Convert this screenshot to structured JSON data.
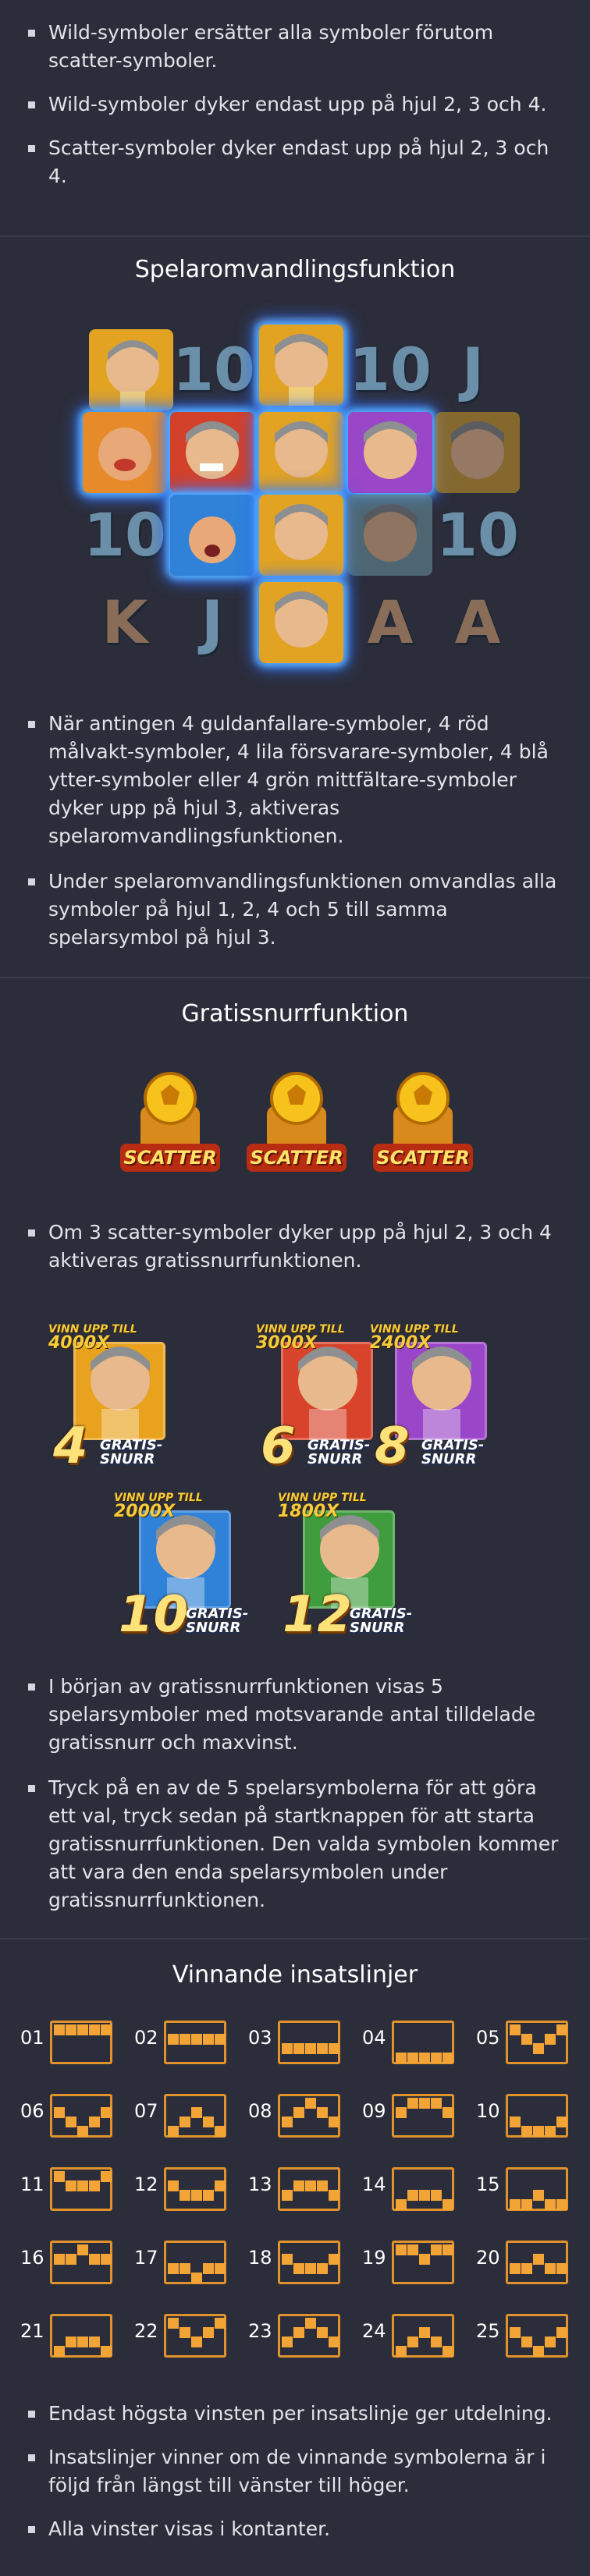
{
  "intro_rules": [
    "Wild-symboler ersätter alla symboler förutom scatter-symboler.",
    "Wild-symboler dyker endast upp på hjul 2, 3 och 4.",
    "Scatter-symboler dyker endast upp på hjul 2, 3 och 4."
  ],
  "player_transform": {
    "title": "Spelaromvandlingsfunktion",
    "rules": [
      "När antingen 4 guldanfallare-symboler, 4 röd målvakt-symboler, 4 lila försvarare-symboler, 4 blå ytter-symboler eller 4 grön mittfältare-symboler dyker upp på hjul 3, aktiveras spelaromvandlingsfunktionen.",
      "Under spelaromvandlingsfunktionen omvandlas alla symboler på hjul 1, 2, 4 och 5 till samma spelarsymbol på hjul 3."
    ],
    "reel_letters": {
      "ten": "10",
      "j": "J",
      "k": "K",
      "a": "A"
    }
  },
  "free_spins": {
    "title": "Gratissnurrfunktion",
    "scatter_label": "SCATTER",
    "trigger_rule": "Om 3 scatter-symboler dyker upp på hjul 2, 3 och 4 aktiveras gratissnurrfunktionen.",
    "options": [
      {
        "tag": "VINN UPP TILL",
        "multiplier": "4000X",
        "spins": "4",
        "word": "GRATIS-\nSNURR",
        "color": "#e8a21e"
      },
      {
        "tag": "VINN UPP TILL",
        "multiplier": "3000X",
        "spins": "6",
        "word": "GRATIS-\nSNURR",
        "color": "#d8432b"
      },
      {
        "tag": "VINN UPP TILL",
        "multiplier": "2400X",
        "spins": "8",
        "word": "GRATIS-\nSNURR",
        "color": "#9a46c8"
      },
      {
        "tag": "VINN UPP TILL",
        "multiplier": "2000X",
        "spins": "10",
        "word": "GRATIS-\nSNURR",
        "color": "#2f82d8"
      },
      {
        "tag": "VINN UPP TILL",
        "multiplier": "1800X",
        "spins": "12",
        "word": "GRATIS-\nSNURR",
        "color": "#3f9d3e"
      }
    ],
    "rules": [
      "I början av gratissnurrfunktionen visas 5 spelarsymboler med motsvarande antal tilldelade gratissnurr och maxvinst.",
      "Tryck på en av de 5 spelarsymbolerna för att göra ett val, tryck sedan på startknappen för att starta gratissnurrfunktionen. Den valda symbolen kommer att vara den enda spelarsymbolen under gratissnurrfunktionen."
    ]
  },
  "paylines": {
    "title": "Vinnande insatslinjer",
    "lines": [
      {
        "num": "01",
        "rows": [
          0,
          0,
          0,
          0,
          0
        ]
      },
      {
        "num": "02",
        "rows": [
          1,
          1,
          1,
          1,
          1
        ]
      },
      {
        "num": "03",
        "rows": [
          2,
          2,
          2,
          2,
          2
        ]
      },
      {
        "num": "04",
        "rows": [
          3,
          3,
          3,
          3,
          3
        ]
      },
      {
        "num": "05",
        "rows": [
          0,
          1,
          2,
          1,
          0
        ]
      },
      {
        "num": "06",
        "rows": [
          1,
          2,
          3,
          2,
          1
        ]
      },
      {
        "num": "07",
        "rows": [
          3,
          2,
          1,
          2,
          3
        ]
      },
      {
        "num": "08",
        "rows": [
          2,
          1,
          0,
          1,
          2
        ]
      },
      {
        "num": "09",
        "rows": [
          1,
          0,
          0,
          0,
          1
        ]
      },
      {
        "num": "10",
        "rows": [
          2,
          3,
          3,
          3,
          2
        ]
      },
      {
        "num": "11",
        "rows": [
          0,
          1,
          1,
          1,
          0
        ]
      },
      {
        "num": "12",
        "rows": [
          1,
          2,
          2,
          2,
          1
        ]
      },
      {
        "num": "13",
        "rows": [
          2,
          1,
          1,
          1,
          2
        ]
      },
      {
        "num": "14",
        "rows": [
          3,
          2,
          2,
          2,
          3
        ]
      },
      {
        "num": "15",
        "rows": [
          3,
          3,
          2,
          3,
          3
        ]
      },
      {
        "num": "16",
        "rows": [
          1,
          1,
          0,
          1,
          1
        ]
      },
      {
        "num": "17",
        "rows": [
          2,
          2,
          3,
          2,
          2
        ]
      },
      {
        "num": "18",
        "rows": [
          1,
          2,
          2,
          2,
          1
        ]
      },
      {
        "num": "19",
        "rows": [
          0,
          0,
          1,
          0,
          0
        ]
      },
      {
        "num": "20",
        "rows": [
          2,
          2,
          1,
          2,
          2
        ]
      },
      {
        "num": "21",
        "rows": [
          3,
          2,
          2,
          2,
          3
        ]
      },
      {
        "num": "22",
        "rows": [
          0,
          1,
          2,
          1,
          0
        ]
      },
      {
        "num": "23",
        "rows": [
          2,
          1,
          0,
          1,
          2
        ]
      },
      {
        "num": "24",
        "rows": [
          3,
          2,
          1,
          2,
          3
        ]
      },
      {
        "num": "25",
        "rows": [
          1,
          2,
          3,
          2,
          1
        ]
      }
    ],
    "rules": [
      "Endast högsta vinsten per insatslinje ger utdelning.",
      "Insatslinjer vinner om de vinnande symbolerna är i följd från längst till vänster till höger.",
      "Alla vinster visas i kontanter."
    ]
  }
}
